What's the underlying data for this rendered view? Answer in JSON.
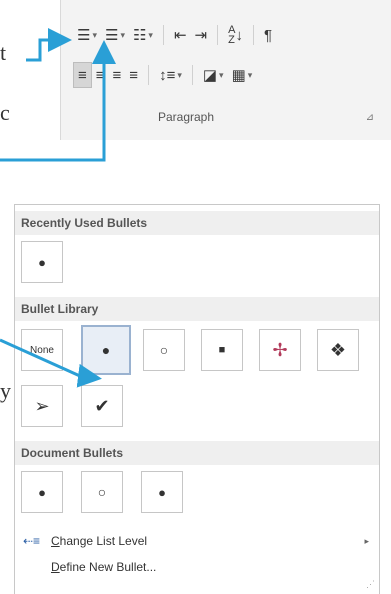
{
  "ribbon": {
    "group_label": "Paragraph",
    "row1": [
      {
        "icon": "bullets-icon",
        "glyph": "☰",
        "has_dropdown": true
      },
      {
        "icon": "numbering-icon",
        "glyph": "☰",
        "has_dropdown": true
      },
      {
        "icon": "multilevel-list-icon",
        "glyph": "☷",
        "has_dropdown": true
      },
      {
        "icon": "decrease-indent-icon",
        "glyph": "⇤"
      },
      {
        "icon": "increase-indent-icon",
        "glyph": "⇥"
      },
      {
        "icon": "sort-icon",
        "glyph": "↓"
      },
      {
        "icon": "show-formatting-marks-icon",
        "glyph": "¶"
      }
    ],
    "row2": [
      {
        "icon": "align-left-icon",
        "glyph": "≡",
        "active": true
      },
      {
        "icon": "align-center-icon",
        "glyph": "≡"
      },
      {
        "icon": "align-right-icon",
        "glyph": "≡"
      },
      {
        "icon": "justify-icon",
        "glyph": "≡"
      },
      {
        "icon": "line-spacing-icon",
        "glyph": "↕",
        "has_dropdown": true
      },
      {
        "icon": "shading-icon",
        "glyph": "◪",
        "has_dropdown": true
      },
      {
        "icon": "borders-icon",
        "glyph": "▦",
        "has_dropdown": true
      }
    ]
  },
  "gallery": {
    "recently_used_label": "Recently Used Bullets",
    "bullet_library_label": "Bullet Library",
    "document_bullets_label": "Document Bullets",
    "none_label": "None",
    "recently_used": [
      "●"
    ],
    "library": [
      "None",
      "●",
      "○",
      "■",
      "✢",
      "❖",
      "➢",
      "✔"
    ],
    "document_bullets": [
      "●",
      "○",
      "●"
    ],
    "change_list_level_label": "Change List Level",
    "define_new_bullet_label": "Define New Bullet..."
  },
  "colors": {
    "callout_arrow": "#2a9fd6",
    "selected_cell_bg": "#e8eef6",
    "selected_cell_border": "#9ab2d0",
    "section_header_bg": "#efefef"
  }
}
